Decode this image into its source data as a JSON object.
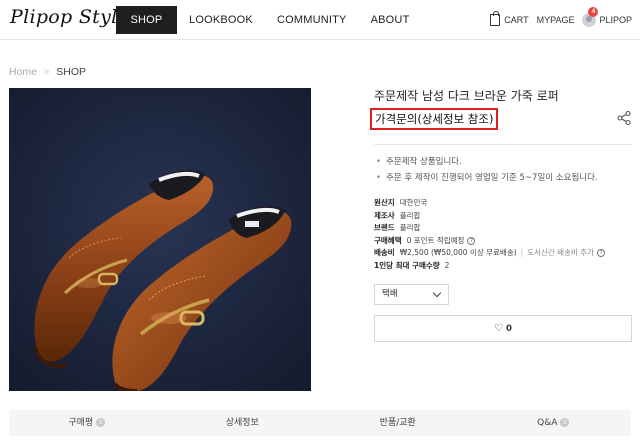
{
  "header": {
    "logo": "Plipop Style",
    "nav": [
      {
        "label": "SHOP",
        "active": true
      },
      {
        "label": "LOOKBOOK",
        "active": false
      },
      {
        "label": "COMMUNITY",
        "active": false
      },
      {
        "label": "ABOUT",
        "active": false
      }
    ],
    "cart_label": "CART",
    "mypage_label": "MYPAGE",
    "user_label": "PLIPOP",
    "notification_count": "4"
  },
  "breadcrumb": {
    "home": "Home",
    "current": "SHOP"
  },
  "product": {
    "title": "주문제작 남성 다크 브라운 가죽 로퍼",
    "price": "가격문의(상세정보 참조)",
    "notes": [
      "주문제작 상품입니다.",
      "주문 후 제작이 진행되어 영업일 기준 5~7일이 소요됩니다."
    ],
    "specs": {
      "origin_label": "원산지",
      "origin": "대한민국",
      "maker_label": "제조사",
      "maker": "플리팝",
      "brand_label": "브랜드",
      "brand": "플리팝",
      "benefit_label": "구매혜택",
      "benefit": "0 포인트 적립예정",
      "shipping_label": "배송비",
      "shipping": "₩2,500 (₩50,000 이상 무료배송)",
      "shipping_extra": "도서산간 배송비 추가",
      "max_label": "1인당 최대 구매수량",
      "max": "2"
    },
    "delivery_select": "택배",
    "like_count": "0"
  },
  "tabs": [
    {
      "label": "구매평",
      "count": "0"
    },
    {
      "label": "상세정보",
      "count": null
    },
    {
      "label": "반품/교환",
      "count": null
    },
    {
      "label": "Q&A",
      "count": "0"
    }
  ],
  "icons": [
    "cart-icon",
    "avatar-icon",
    "share-icon",
    "question-icon",
    "chevron-down-icon",
    "heart-icon"
  ],
  "colors": {
    "nav_active_bg": "#1e1e1e",
    "price_highlight": "#e0201f",
    "badge": "#e8453c",
    "tab_bg": "#f5f5f5"
  }
}
